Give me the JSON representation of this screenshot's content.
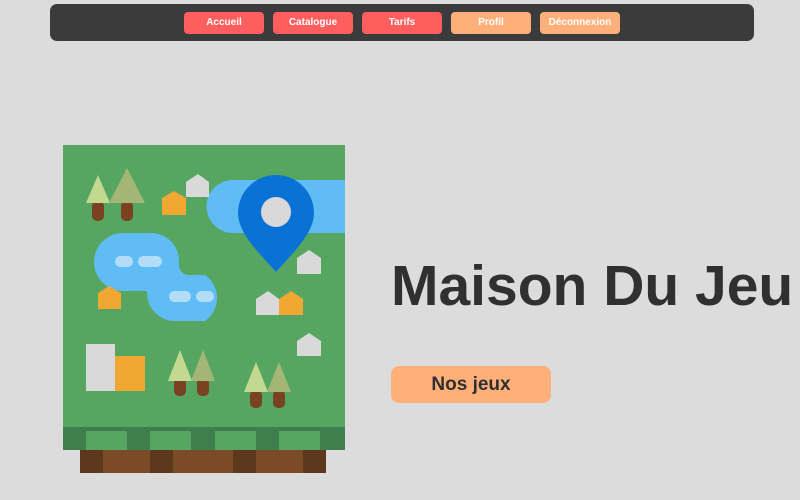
{
  "nav": {
    "items": [
      {
        "label": "Accueil",
        "color": "#ff5e5e"
      },
      {
        "label": "Catalogue",
        "color": "#ff5e5e"
      },
      {
        "label": "Tarifs",
        "color": "#ff5e5e"
      },
      {
        "label": "Profil",
        "color": "#ffb07a"
      },
      {
        "label": "Déconnexion",
        "color": "#ffb07a"
      }
    ]
  },
  "hero": {
    "title": "Maison Du Jeu",
    "cta_label": "Nos jeux"
  },
  "colors": {
    "background": "#dcdcdc",
    "navbar": "#3b3b3b",
    "accent_red": "#ff5e5e",
    "accent_orange": "#ffb07a",
    "text_dark": "#303030"
  },
  "illustration": {
    "icon": "map-illustration"
  }
}
